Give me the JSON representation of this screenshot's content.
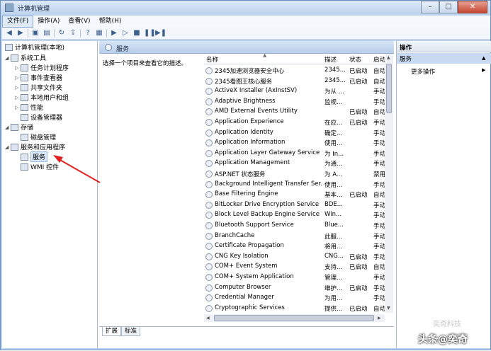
{
  "window": {
    "title": "计算机管理"
  },
  "menu": [
    "文件(F)",
    "操作(A)",
    "查看(V)",
    "帮助(H)"
  ],
  "tree": {
    "root": "计算机管理(本地)",
    "items": [
      {
        "label": "系统工具",
        "icon": "tools-icon",
        "level": 1,
        "expand": "◢"
      },
      {
        "label": "任务计划程序",
        "icon": "clock-icon",
        "level": 2,
        "expand": "▷"
      },
      {
        "label": "事件查看器",
        "icon": "event-viewer-icon",
        "level": 2,
        "expand": "▷"
      },
      {
        "label": "共享文件夹",
        "icon": "shared-folder-icon",
        "level": 2,
        "expand": "▷"
      },
      {
        "label": "本地用户和组",
        "icon": "users-icon",
        "level": 2,
        "expand": "▷"
      },
      {
        "label": "性能",
        "icon": "performance-icon",
        "level": 2,
        "expand": "▷"
      },
      {
        "label": "设备管理器",
        "icon": "device-manager-icon",
        "level": 2,
        "expand": ""
      },
      {
        "label": "存储",
        "icon": "storage-icon",
        "level": 1,
        "expand": "◢"
      },
      {
        "label": "磁盘管理",
        "icon": "disk-icon",
        "level": 2,
        "expand": ""
      },
      {
        "label": "服务和应用程序",
        "icon": "services-apps-icon",
        "level": 1,
        "expand": "◢"
      },
      {
        "label": "服务",
        "icon": "gear-icon",
        "level": 2,
        "expand": "",
        "selected": true
      },
      {
        "label": "WMI 控件",
        "icon": "wmi-icon",
        "level": 2,
        "expand": ""
      }
    ]
  },
  "middle": {
    "header": "服务",
    "hint": "选择一个项目来查看它的描述。",
    "columns": [
      "名称",
      "描述",
      "状态",
      "启动"
    ],
    "rows": [
      {
        "name": "2345加速浏览器安全中心",
        "desc": "2345...",
        "status": "已启动",
        "start": "自动"
      },
      {
        "name": "2345看图王核心服务",
        "desc": "2345...",
        "status": "已启动",
        "start": "自动"
      },
      {
        "name": "ActiveX Installer (AxInstSV)",
        "desc": "为从 ...",
        "status": "",
        "start": "手动"
      },
      {
        "name": "Adaptive Brightness",
        "desc": "监视...",
        "status": "",
        "start": "手动"
      },
      {
        "name": "AMD External Events Utility",
        "desc": "",
        "status": "已启动",
        "start": "自动"
      },
      {
        "name": "Application Experience",
        "desc": "在应...",
        "status": "已启动",
        "start": "手动"
      },
      {
        "name": "Application Identity",
        "desc": "确定...",
        "status": "",
        "start": "手动"
      },
      {
        "name": "Application Information",
        "desc": "使用...",
        "status": "",
        "start": "手动"
      },
      {
        "name": "Application Layer Gateway Service",
        "desc": "为 In...",
        "status": "",
        "start": "手动"
      },
      {
        "name": "Application Management",
        "desc": "为通...",
        "status": "",
        "start": "手动"
      },
      {
        "name": "ASP.NET 状态服务",
        "desc": "为 A...",
        "status": "",
        "start": "禁用"
      },
      {
        "name": "Background Intelligent Transfer Ser...",
        "desc": "使用...",
        "status": "",
        "start": "手动"
      },
      {
        "name": "Base Filtering Engine",
        "desc": "基本...",
        "status": "已启动",
        "start": "自动"
      },
      {
        "name": "BitLocker Drive Encryption Service",
        "desc": "BDE...",
        "status": "",
        "start": "手动"
      },
      {
        "name": "Block Level Backup Engine Service",
        "desc": "Win...",
        "status": "",
        "start": "手动"
      },
      {
        "name": "Bluetooth Support Service",
        "desc": "Blue...",
        "status": "",
        "start": "手动"
      },
      {
        "name": "BranchCache",
        "desc": "此服...",
        "status": "",
        "start": "手动"
      },
      {
        "name": "Certificate Propagation",
        "desc": "将用...",
        "status": "",
        "start": "手动"
      },
      {
        "name": "CNG Key Isolation",
        "desc": "CNG...",
        "status": "已启动",
        "start": "手动"
      },
      {
        "name": "COM+ Event System",
        "desc": "支持...",
        "status": "已启动",
        "start": "自动"
      },
      {
        "name": "COM+ System Application",
        "desc": "管理...",
        "status": "",
        "start": "手动"
      },
      {
        "name": "Computer Browser",
        "desc": "维护...",
        "status": "已启动",
        "start": "手动"
      },
      {
        "name": "Credential Manager",
        "desc": "为用...",
        "status": "",
        "start": "手动"
      },
      {
        "name": "Cryptographic Services",
        "desc": "提供...",
        "status": "已启动",
        "start": "自动"
      }
    ],
    "tabs": [
      "扩展",
      "标准"
    ]
  },
  "actions": {
    "header": "操作",
    "section": "服务",
    "more": "更多操作"
  },
  "watermark": "头条@奕奇",
  "watermark_faint": "奕奇科技"
}
